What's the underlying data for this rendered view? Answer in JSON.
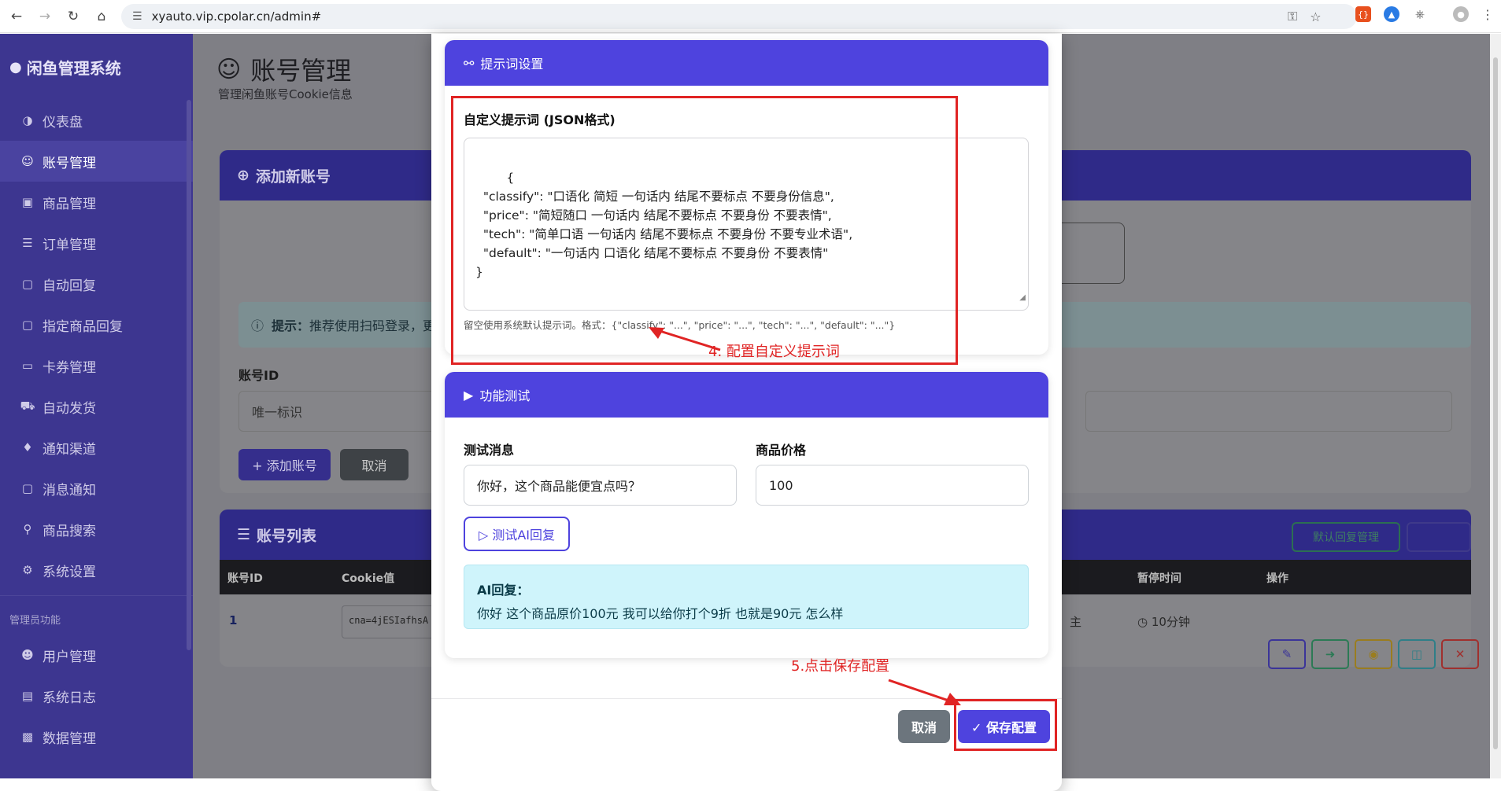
{
  "browser": {
    "url": "xyauto.vip.cpolar.cn/admin#"
  },
  "sidebar": {
    "brand": "闲鱼管理系统",
    "items": [
      {
        "icon": "gauge-icon",
        "label": "仪表盘"
      },
      {
        "icon": "user-circle-icon",
        "label": "账号管理"
      },
      {
        "icon": "box-icon",
        "label": "商品管理"
      },
      {
        "icon": "list-icon",
        "label": "订单管理"
      },
      {
        "icon": "chat-icon",
        "label": "自动回复"
      },
      {
        "icon": "chat-icon",
        "label": "指定商品回复"
      },
      {
        "icon": "card-icon",
        "label": "卡券管理"
      },
      {
        "icon": "truck-icon",
        "label": "自动发货"
      },
      {
        "icon": "bell-icon",
        "label": "通知渠道"
      },
      {
        "icon": "chat-icon",
        "label": "消息通知"
      },
      {
        "icon": "search-icon",
        "label": "商品搜索"
      },
      {
        "icon": "gear-icon",
        "label": "系统设置"
      }
    ],
    "admin_section": "管理员功能",
    "admin_items": [
      {
        "icon": "users-icon",
        "label": "用户管理"
      },
      {
        "icon": "doc-icon",
        "label": "系统日志"
      },
      {
        "icon": "database-icon",
        "label": "数据管理"
      }
    ]
  },
  "page": {
    "title": "账号管理",
    "subtitle": "管理闲鱼账号Cookie信息",
    "add_card_title": "添加新账号",
    "tip_label": "提示：",
    "tip_text": "推荐使用扫码登录，更",
    "account_id_label": "账号ID",
    "account_id_placeholder": "唯一标识",
    "add_button": "+ 添加账号",
    "cancel_button": "取消",
    "list_title": "账号列表",
    "default_reply_button": "默认回复管理",
    "columns": [
      "账号ID",
      "Cookie值",
      "暂停时间",
      "操作"
    ],
    "row": {
      "id": "1",
      "cookie": "cna=4jESIafhsA",
      "status": "主",
      "pause": "10分钟"
    }
  },
  "modal": {
    "prompt_section_title": "提示词设置",
    "prompt_label": "自定义提示词 (JSON格式)",
    "prompt_value": "{\n  \"classify\": \"口语化 简短 一句话内 结尾不要标点 不要身份信息\",\n  \"price\": \"简短随口 一句话内 结尾不要标点 不要身份 不要表情\",\n  \"tech\": \"简单口语 一句话内 结尾不要标点 不要身份 不要专业术语\",\n  \"default\": \"一句话内 口语化 结尾不要标点 不要身份 不要表情\"\n}",
    "prompt_hint": "留空使用系统默认提示词。格式：{\"classify\": \"...\", \"price\": \"...\", \"tech\": \"...\", \"default\": \"...\"}",
    "test_section_title": "功能测试",
    "test_msg_label": "测试消息",
    "test_msg_value": "你好，这个商品能便宜点吗？",
    "price_label": "商品价格",
    "price_value": "100",
    "test_button": "▷ 测试AI回复",
    "reply_label": "AI回复：",
    "reply_text": "你好 这个商品原价100元 我可以给你打个9折 也就是90元 怎么样",
    "cancel": "取消",
    "save": "✓ 保存配置"
  },
  "annotations": {
    "step4": "4. 配置自定义提示词",
    "step5": "5.点击保存配置"
  },
  "colors": {
    "accent": "#4e43de",
    "sidebar": "#3d3690",
    "annotation": "#e02424"
  }
}
